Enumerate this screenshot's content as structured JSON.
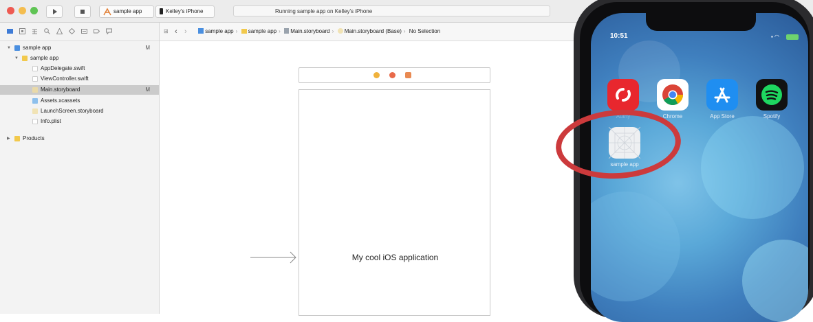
{
  "toolbar": {
    "scheme_target": "sample app",
    "device": "Kelley's iPhone",
    "status": "Running sample app on Kelley's iPhone",
    "colors": {
      "close": "#ee5a52",
      "minimize": "#f4bd4f",
      "zoom": "#5fc454"
    },
    "run_icon": "play-icon",
    "stop_icon": "stop-icon"
  },
  "navigator": {
    "icons": [
      "folder-icon",
      "source-control-icon",
      "symbol-icon",
      "search-icon",
      "issue-icon",
      "test-icon",
      "debug-icon",
      "breakpoint-icon",
      "report-icon"
    ],
    "tree": [
      {
        "label": "sample app",
        "badge": "M",
        "kind": "project",
        "selected": false
      },
      {
        "label": "sample app",
        "badge": "",
        "kind": "folder",
        "selected": false
      },
      {
        "label": "AppDelegate.swift",
        "badge": "",
        "kind": "swift",
        "selected": false
      },
      {
        "label": "ViewController.swift",
        "badge": "",
        "kind": "swift",
        "selected": false
      },
      {
        "label": "Main.storyboard",
        "badge": "M",
        "kind": "storyboard",
        "selected": true
      },
      {
        "label": "Assets.xcassets",
        "badge": "",
        "kind": "assets",
        "selected": false
      },
      {
        "label": "LaunchScreen.storyboard",
        "badge": "",
        "kind": "storyboard",
        "selected": false
      },
      {
        "label": "Info.plist",
        "badge": "",
        "kind": "plist",
        "selected": false
      },
      {
        "label": "Products",
        "badge": "",
        "kind": "folder",
        "selected": false
      }
    ]
  },
  "jumpbar": {
    "crumbs": [
      "sample app",
      "sample app",
      "Main.storyboard",
      "Main.storyboard (Base)",
      "No Selection"
    ]
  },
  "canvas": {
    "view_label": "My cool iOS application"
  },
  "phone": {
    "time": "10:51",
    "apps": [
      {
        "label": "Authy",
        "color": "#e8272e",
        "icon": "authy-icon"
      },
      {
        "label": "Chrome",
        "color": "#ffffff",
        "icon": "chrome-icon"
      },
      {
        "label": "App Store",
        "color": "#1f8ef1",
        "icon": "app-store-icon"
      },
      {
        "label": "Spotify",
        "color": "#121212",
        "icon": "spotify-icon"
      }
    ],
    "new_app": {
      "label": "sample app",
      "icon": "blank-app-icon"
    },
    "highlight_color": "#cc3a3c"
  }
}
